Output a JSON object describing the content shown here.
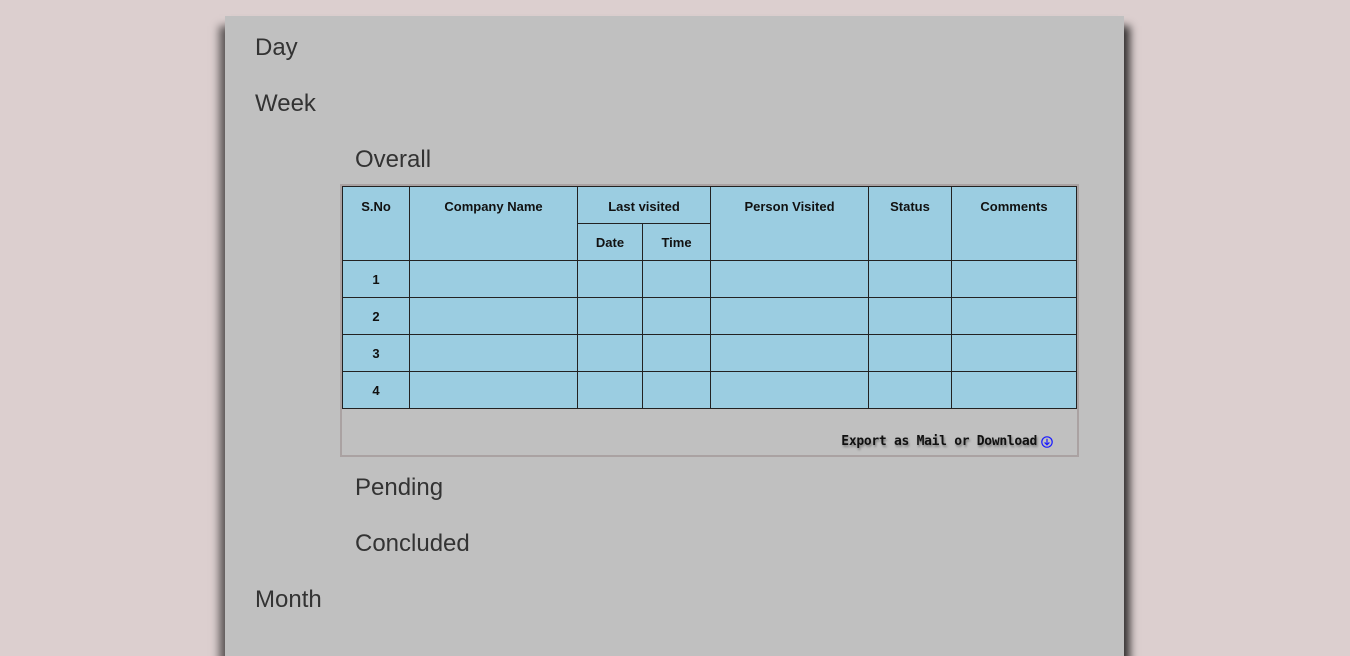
{
  "nav": {
    "day": "Day",
    "week": "Week",
    "overall": "Overall",
    "pending": "Pending",
    "concluded": "Concluded",
    "month": "Month"
  },
  "table": {
    "headers": {
      "sno": "S.No",
      "company": "Company Name",
      "last_visited": "Last visited",
      "date": "Date",
      "time": "Time",
      "person": "Person Visited",
      "status": "Status",
      "comments": "Comments"
    },
    "rows": [
      {
        "sno": "1"
      },
      {
        "sno": "2"
      },
      {
        "sno": "3"
      },
      {
        "sno": "4"
      }
    ]
  },
  "export": {
    "label": "Export as Mail or Download",
    "icon": "download-circle-icon"
  },
  "colors": {
    "table_bg": "#9bcde1",
    "panel_bg": "#c0c0c0",
    "page_bg": "#dccfcf",
    "icon": "#1a1aff"
  }
}
